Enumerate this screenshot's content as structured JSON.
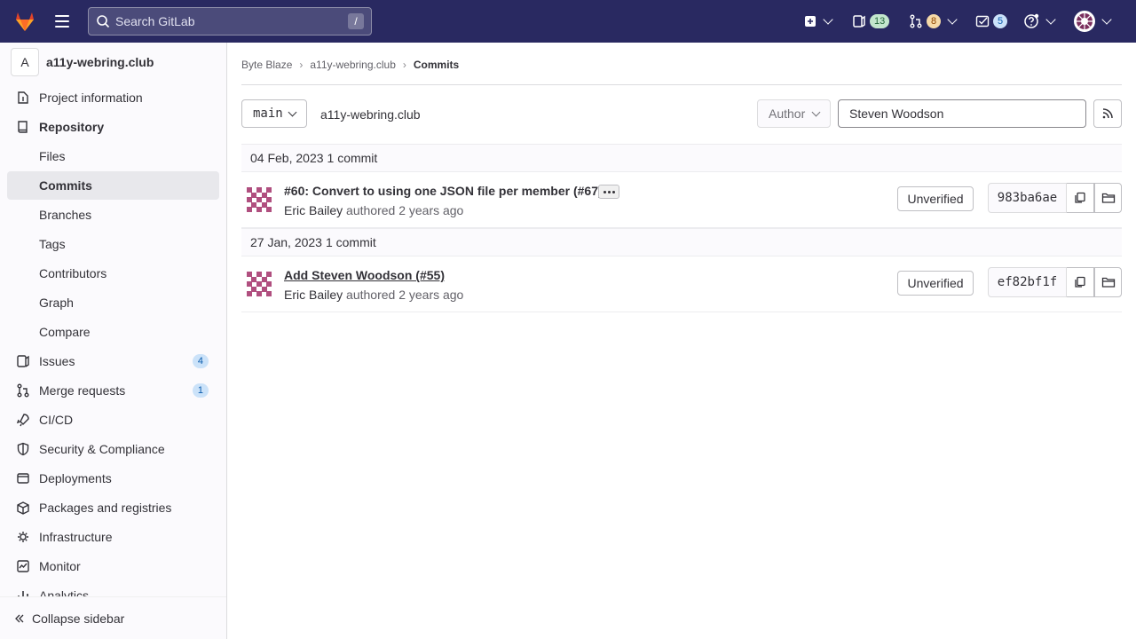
{
  "topbar": {
    "logo_icon": "gitlab-tanuki-icon",
    "menu_icon": "hamburger-icon",
    "search_placeholder": "Search GitLab",
    "search_shortcut": "/",
    "issues_count": "13",
    "merge_requests_count": "8",
    "todos_count": "5",
    "colors": {
      "bg": "#292961",
      "issues_pill": "#c3e6cd",
      "mr_pill": "#f5d9a8",
      "todos_pill": "#cbe2f9"
    }
  },
  "sidebar": {
    "project_initial": "A",
    "project_name": "a11y-webring.club",
    "items": [
      {
        "label": "Project information",
        "icon": "info-icon"
      },
      {
        "label": "Repository",
        "icon": "repository-icon"
      },
      {
        "label": "Files"
      },
      {
        "label": "Commits"
      },
      {
        "label": "Branches"
      },
      {
        "label": "Tags"
      },
      {
        "label": "Contributors"
      },
      {
        "label": "Graph"
      },
      {
        "label": "Compare"
      },
      {
        "label": "Issues",
        "icon": "issues-icon",
        "count": "4"
      },
      {
        "label": "Merge requests",
        "icon": "merge-request-icon",
        "count": "1"
      },
      {
        "label": "CI/CD",
        "icon": "rocket-icon"
      },
      {
        "label": "Security & Compliance",
        "icon": "shield-icon"
      },
      {
        "label": "Deployments",
        "icon": "deployments-icon"
      },
      {
        "label": "Packages and registries",
        "icon": "package-icon"
      },
      {
        "label": "Infrastructure",
        "icon": "cloud-gear-icon"
      },
      {
        "label": "Monitor",
        "icon": "monitor-icon"
      },
      {
        "label": "Analytics",
        "icon": "chart-icon"
      }
    ],
    "collapse_label": "Collapse sidebar"
  },
  "breadcrumb": {
    "group": "Byte Blaze",
    "project": "a11y-webring.club",
    "current": "Commits"
  },
  "toolbar": {
    "branch": "main",
    "path": "a11y-webring.club",
    "author_label": "Author",
    "author_value": "Steven Woodson"
  },
  "commit_groups": [
    {
      "date": "04 Feb, 2023",
      "count_label": "1 commit",
      "commit": {
        "title": "#60: Convert to using one JSON file per member (#67)",
        "author": "Eric Bailey",
        "authored_text": "authored 2 years ago",
        "signature": "Unverified",
        "sha": "983ba6ae"
      }
    },
    {
      "date": "27 Jan, 2023",
      "count_label": "1 commit",
      "commit": {
        "title": "Add Steven Woodson (#55)",
        "author": "Eric Bailey",
        "authored_text": "authored 2 years ago",
        "signature": "Unverified",
        "sha": "ef82bf1f"
      }
    }
  ]
}
